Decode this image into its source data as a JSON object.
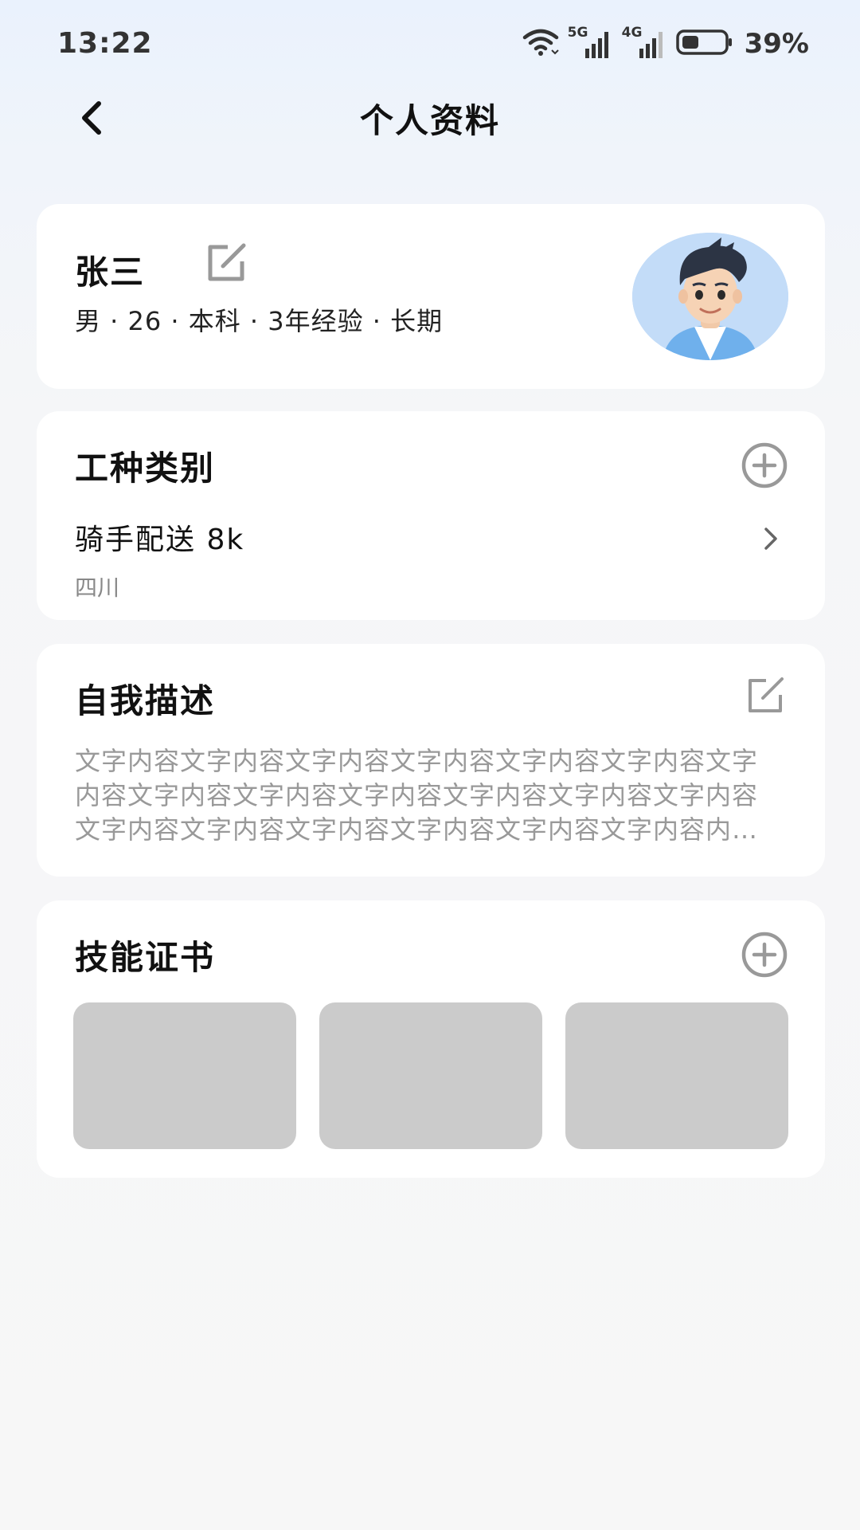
{
  "status_bar": {
    "time": "13:22",
    "signal_1_label": "5G",
    "signal_2_label": "4G",
    "battery_percent": "39%",
    "battery_level": 0.39,
    "icons": [
      "wifi-icon",
      "signal-5g-icon",
      "signal-4g-icon",
      "battery-icon"
    ]
  },
  "header": {
    "title": "个人资料",
    "back_icon": "chevron-left-icon"
  },
  "profile": {
    "name": "张三",
    "meta": "男 · 26 · 本科 · 3年经验 · 长期",
    "edit_icon": "edit-icon",
    "avatar": "avatar-illustration"
  },
  "job_type": {
    "title": "工种类别",
    "add_icon": "plus-circle-icon",
    "items": [
      {
        "title": "骑手配送 8k",
        "location": "四川"
      }
    ]
  },
  "description": {
    "title": "自我描述",
    "edit_icon": "edit-icon",
    "text": "文字内容文字内容文字内容文字内容文字内容文字内容文字内容文字内容文字内容文字内容文字内容文字内容文字内容文字内容文字内容文字内容文字内容文字内容文字内容内容文字内容"
  },
  "certificates": {
    "title": "技能证书",
    "add_icon": "plus-circle-icon",
    "slots": 3
  },
  "colors": {
    "background_top": "#eaf2fd",
    "background": "#f7f7f7",
    "card": "#ffffff",
    "placeholder": "#cbcbcb",
    "muted_text": "#999999",
    "icon_gray": "#999999"
  }
}
